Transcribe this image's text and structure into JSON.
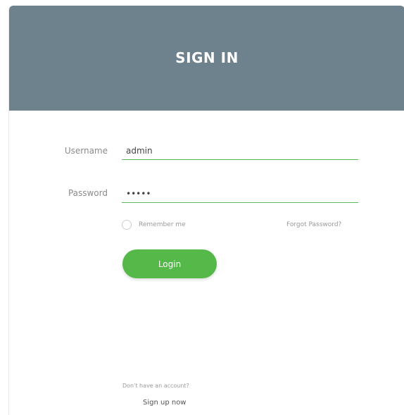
{
  "header": {
    "title": "SIGN IN",
    "background_color": "#6d828d"
  },
  "form": {
    "username_label": "Username",
    "username_value": "admin",
    "password_label": "Password",
    "password_value": "admin",
    "remember_label": "Remember me",
    "forgot_label": "Forgot Password?",
    "login_label": "Login",
    "accent_color": "#55b94a"
  },
  "footer": {
    "no_account_text": "Don't have an account?",
    "signup_label": "Sign up now"
  }
}
